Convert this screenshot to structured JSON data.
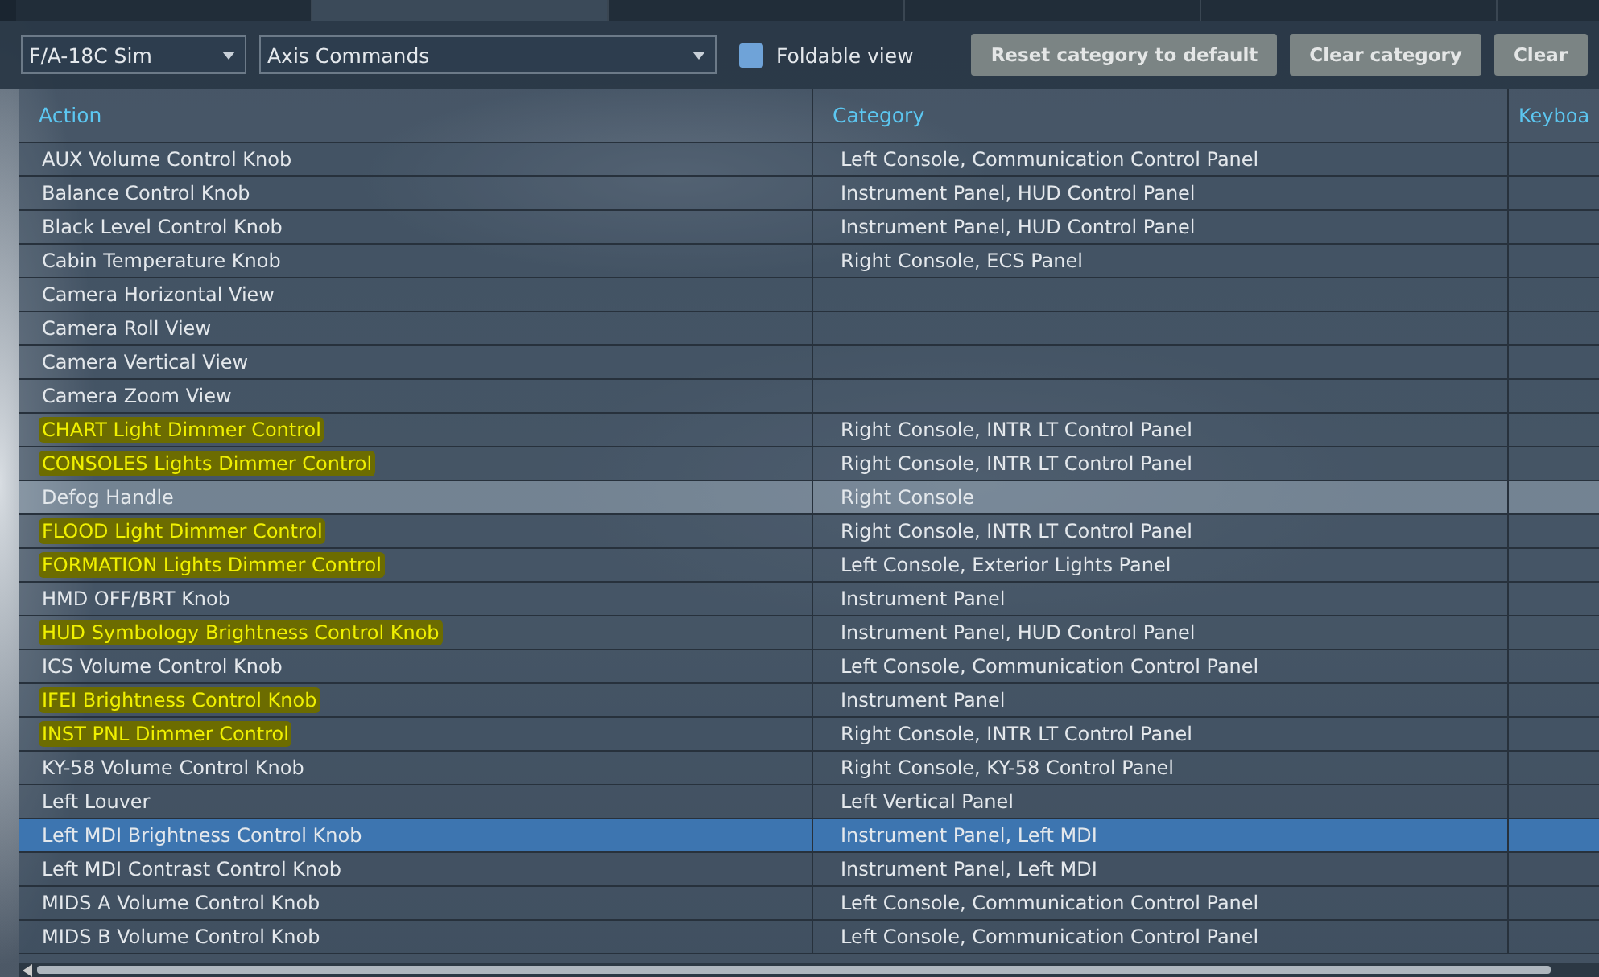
{
  "tabs": [
    {
      "selected": false
    },
    {
      "selected": true
    },
    {
      "selected": false
    },
    {
      "selected": false
    },
    {
      "selected": false
    },
    {
      "selected": false
    }
  ],
  "toolbar": {
    "aircraft": "F/A-18C Sim",
    "category": "Axis Commands",
    "foldable_view": {
      "label": "Foldable view",
      "checked": false
    },
    "buttons": [
      "Reset category to default",
      "Clear category",
      "Clear"
    ]
  },
  "table": {
    "columns": [
      "Action",
      "Category",
      "Keyboa"
    ],
    "rows": [
      {
        "action": "AUX Volume Control Knob",
        "category": "Left Console, Communication Control Panel",
        "highlighted": false,
        "hovered": false,
        "selected": false
      },
      {
        "action": "Balance Control Knob",
        "category": "Instrument Panel, HUD Control Panel",
        "highlighted": false,
        "hovered": false,
        "selected": false
      },
      {
        "action": "Black Level Control Knob",
        "category": "Instrument Panel, HUD Control Panel",
        "highlighted": false,
        "hovered": false,
        "selected": false
      },
      {
        "action": "Cabin Temperature Knob",
        "category": "Right Console, ECS Panel",
        "highlighted": false,
        "hovered": false,
        "selected": false
      },
      {
        "action": "Camera Horizontal View",
        "highlighted": false,
        "hovered": false,
        "selected": false
      },
      {
        "action": "Camera Roll View",
        "highlighted": false,
        "hovered": false,
        "selected": false
      },
      {
        "action": "Camera Vertical View",
        "highlighted": false,
        "hovered": false,
        "selected": false
      },
      {
        "action": "Camera Zoom View",
        "highlighted": false,
        "hovered": false,
        "selected": false
      },
      {
        "action": "CHART Light Dimmer Control",
        "category": "Right Console, INTR LT Control Panel",
        "highlighted": true,
        "hovered": false,
        "selected": false
      },
      {
        "action": "CONSOLES Lights Dimmer Control",
        "category": "Right Console, INTR LT Control Panel",
        "highlighted": true,
        "hovered": false,
        "selected": false
      },
      {
        "action": "Defog Handle",
        "category": "Right Console",
        "highlighted": false,
        "hovered": true,
        "selected": false
      },
      {
        "action": "FLOOD Light Dimmer Control",
        "category": "Right Console, INTR LT Control Panel",
        "highlighted": true,
        "hovered": false,
        "selected": false
      },
      {
        "action": "FORMATION Lights Dimmer Control",
        "category": "Left Console, Exterior Lights Panel",
        "highlighted": true,
        "hovered": false,
        "selected": false
      },
      {
        "action": "HMD OFF/BRT Knob",
        "category": "Instrument Panel",
        "highlighted": false,
        "hovered": false,
        "selected": false
      },
      {
        "action": "HUD Symbology Brightness Control Knob",
        "category": "Instrument Panel, HUD Control Panel",
        "highlighted": true,
        "hovered": false,
        "selected": false
      },
      {
        "action": "ICS Volume Control Knob",
        "category": "Left Console, Communication Control Panel",
        "highlighted": false,
        "hovered": false,
        "selected": false
      },
      {
        "action": "IFEI Brightness Control Knob",
        "category": "Instrument Panel",
        "highlighted": true,
        "hovered": false,
        "selected": false
      },
      {
        "action": "INST PNL Dimmer Control",
        "category": "Right Console, INTR LT Control Panel",
        "highlighted": true,
        "hovered": false,
        "selected": false
      },
      {
        "action": "KY-58 Volume Control Knob",
        "category": "Right Console, KY-58 Control Panel",
        "highlighted": false,
        "hovered": false,
        "selected": false
      },
      {
        "action": "Left Louver",
        "category": "Left Vertical Panel",
        "highlighted": false,
        "hovered": false,
        "selected": false
      },
      {
        "action": "Left MDI Brightness Control Knob",
        "category": "Instrument Panel, Left MDI",
        "highlighted": false,
        "hovered": false,
        "selected": true
      },
      {
        "action": "Left MDI Contrast Control Knob",
        "category": "Instrument Panel, Left MDI",
        "highlighted": false,
        "hovered": false,
        "selected": false
      },
      {
        "action": "MIDS A Volume Control Knob",
        "category": "Left Console, Communication Control Panel",
        "highlighted": false,
        "hovered": false,
        "selected": false
      },
      {
        "action": "MIDS B Volume Control Knob",
        "category": "Left Console, Communication Control Panel",
        "highlighted": false,
        "hovered": false,
        "selected": false
      }
    ]
  }
}
